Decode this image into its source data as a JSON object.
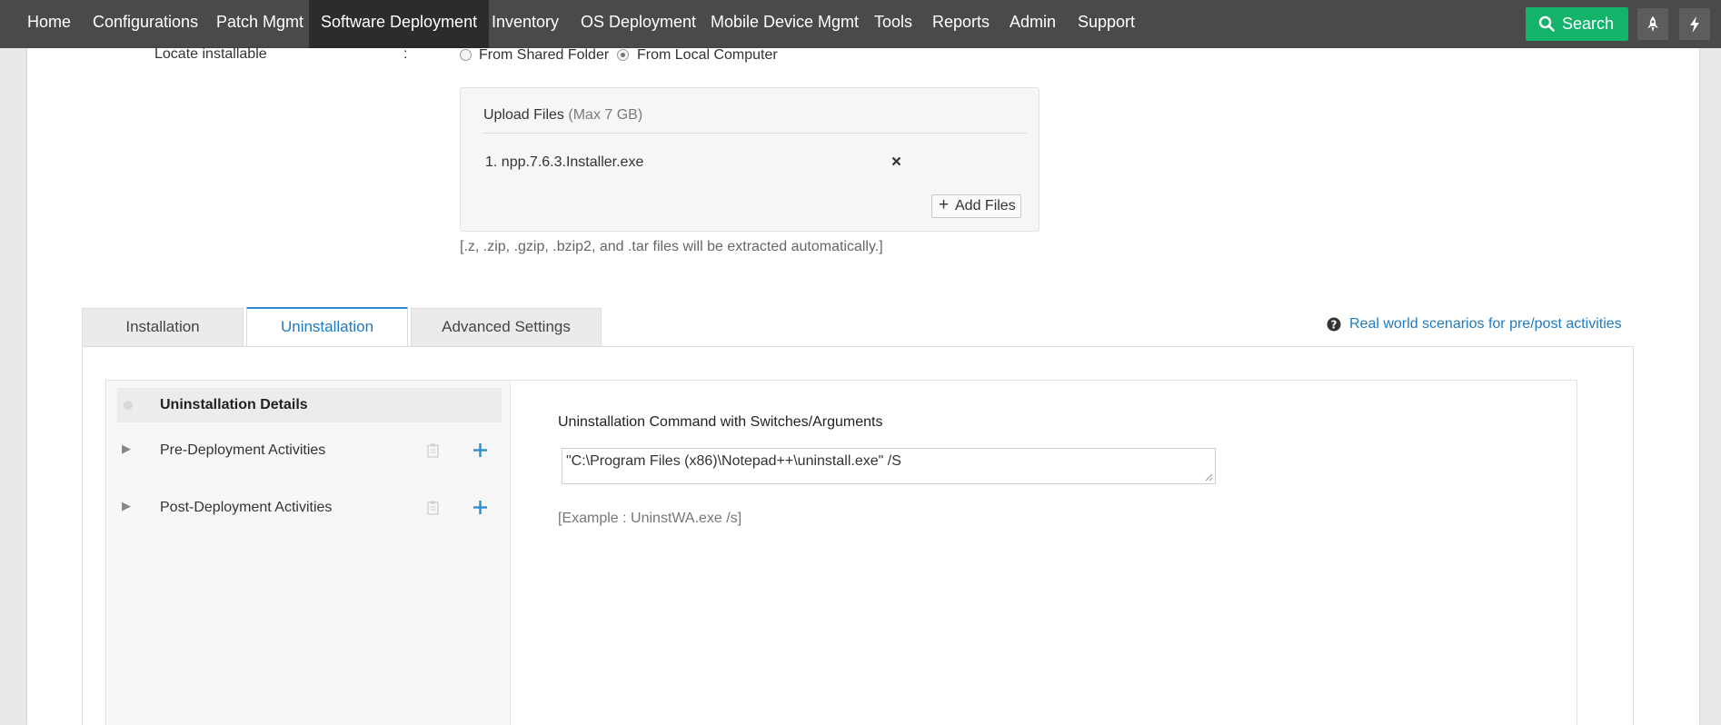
{
  "nav": {
    "items": [
      "Home",
      "Configurations",
      "Patch Mgmt",
      "Software Deployment",
      "Inventory",
      "OS Deployment",
      "Mobile Device Mgmt",
      "Tools",
      "Reports",
      "Admin",
      "Support"
    ],
    "active": "Software Deployment",
    "search_label": "Search"
  },
  "locate": {
    "label": "Locate installable",
    "colon": ":",
    "option_shared": "From Shared Folder",
    "option_local": "From Local Computer",
    "selected": "From Local Computer"
  },
  "upload": {
    "title": "Upload Files",
    "limit": "(Max 7 GB)",
    "files": [
      "1. npp.7.6.3.Installer.exe"
    ],
    "add_files_label": "Add Files",
    "note": "[.z, .zip, .gzip, .bzip2, and .tar files will be extracted automatically.]"
  },
  "tabs": {
    "items": [
      "Installation",
      "Uninstallation",
      "Advanced Settings"
    ],
    "active": "Uninstallation",
    "help_link": "Real world scenarios for pre/post activities"
  },
  "uninstall": {
    "sections": [
      "Uninstallation Details",
      "Pre-Deployment Activities",
      "Post-Deployment Activities"
    ],
    "command_label": "Uninstallation Command with Switches/Arguments",
    "command_value": "\"C:\\Program Files (x86)\\Notepad++\\uninstall.exe\" /S",
    "example": "[Example : UninstWA.exe /s]"
  },
  "colors": {
    "nav_bg": "#4a4a4a",
    "search_green": "#14b36b",
    "link_blue": "#1e7bc0",
    "plus_blue": "#2a8fd0"
  }
}
